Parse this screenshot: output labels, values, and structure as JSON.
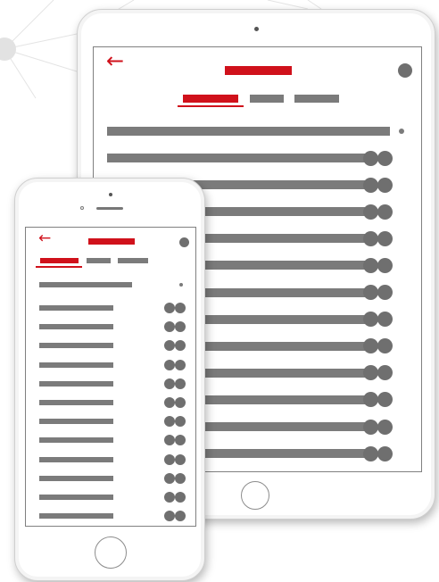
{
  "colors": {
    "accent": "#d0111b",
    "placeholder_gray": "#7b7b7b",
    "network_node": "#e2e2e2"
  },
  "icons": {
    "back": "←",
    "avatar": "avatar-icon",
    "row_actions": "toggle-dots-icon"
  },
  "tablet": {
    "tabs_count": 3,
    "active_tab": 0,
    "row_count": 12
  },
  "phone": {
    "tabs_count": 3,
    "active_tab": 0,
    "row_count": 12
  }
}
